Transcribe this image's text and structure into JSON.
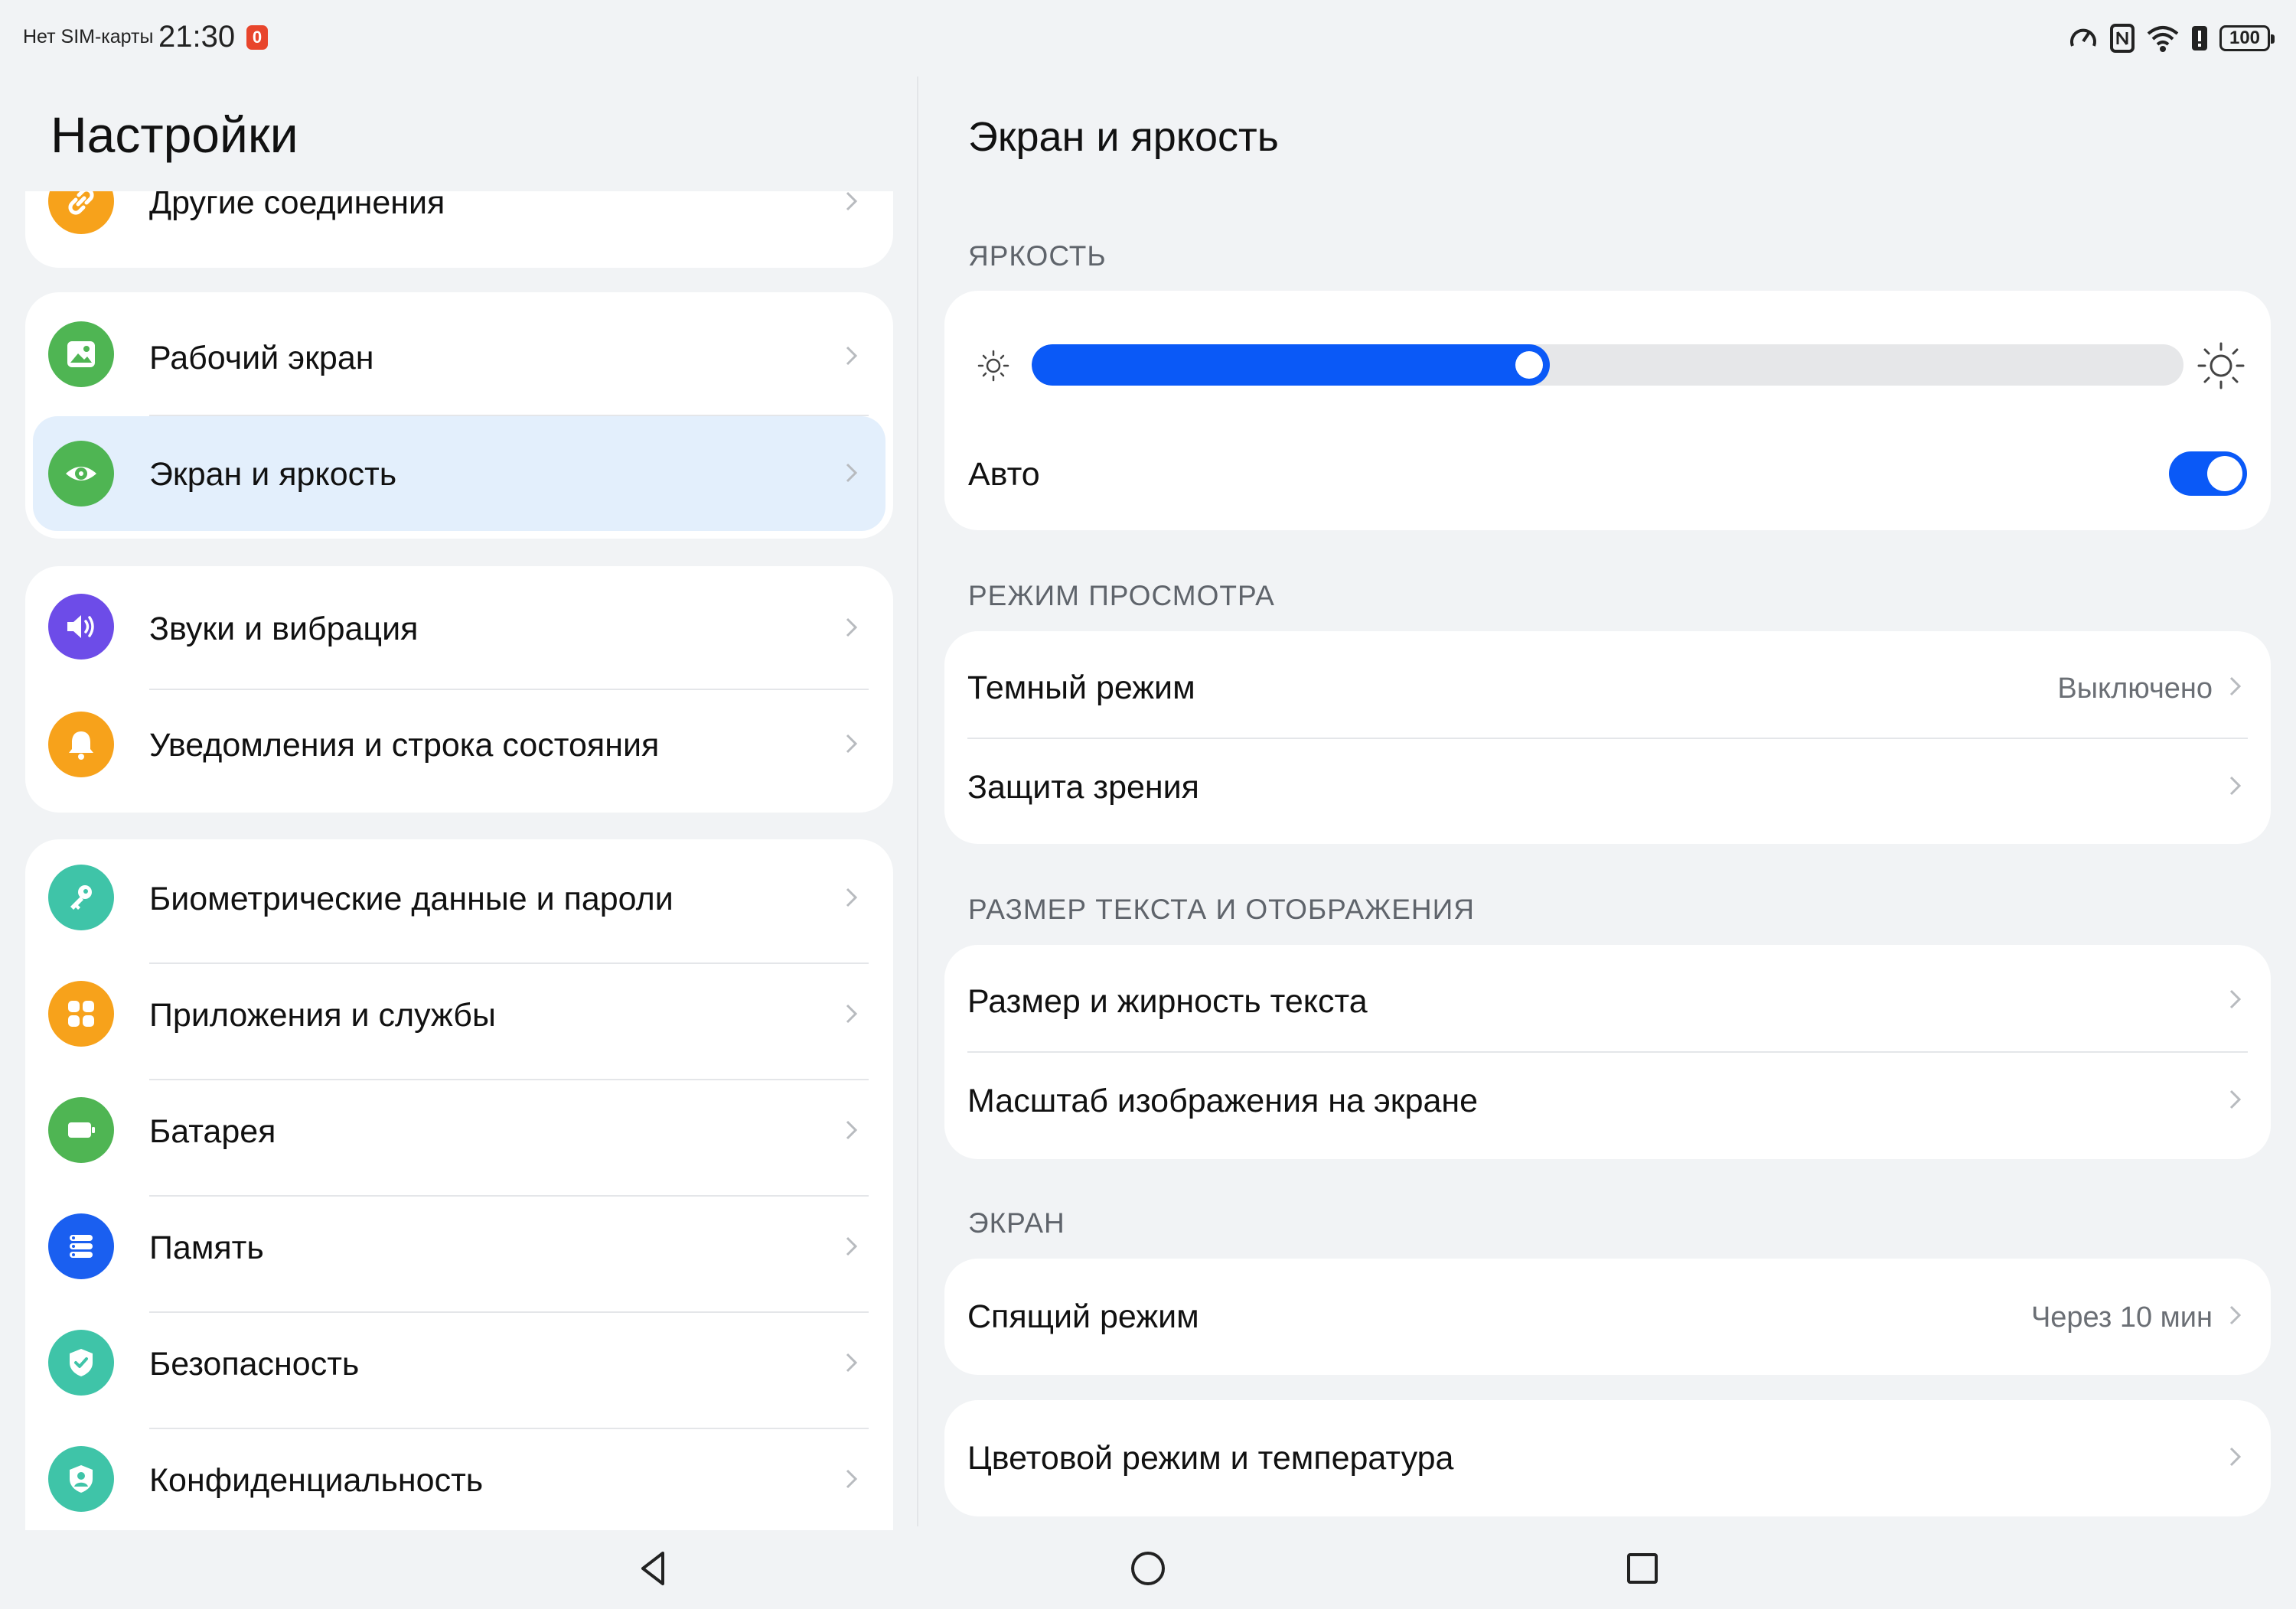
{
  "status_bar": {
    "sim_text": "Нет SIM-карты",
    "time": "21:30",
    "alert_badge": "0",
    "battery_level": "100",
    "icons": [
      "speed-icon",
      "nfc-icon",
      "wifi-icon",
      "battery-alert-icon",
      "battery-icon"
    ]
  },
  "left": {
    "title": "Настройки",
    "items": [
      {
        "label": "Другие соединения",
        "icon": "link-icon",
        "color": "#f7a21b"
      },
      {
        "label": "Рабочий экран",
        "icon": "picture-icon",
        "color": "#4fb553"
      },
      {
        "label": "Экран и яркость",
        "icon": "eye-icon",
        "color": "#4fb553",
        "selected": true
      },
      {
        "label": "Звуки и вибрация",
        "icon": "speaker-icon",
        "color": "#6d4ce8"
      },
      {
        "label": "Уведомления и строка состояния",
        "icon": "bell-icon",
        "color": "#f7a21b"
      },
      {
        "label": "Биометрические данные и пароли",
        "icon": "key-icon",
        "color": "#3fc4a8"
      },
      {
        "label": "Приложения и службы",
        "icon": "apps-icon",
        "color": "#f7a21b"
      },
      {
        "label": "Батарея",
        "icon": "battery-icon",
        "color": "#4fb553"
      },
      {
        "label": "Память",
        "icon": "storage-icon",
        "color": "#1a5ff0"
      },
      {
        "label": "Безопасность",
        "icon": "shield-check-icon",
        "color": "#3fc4a8"
      },
      {
        "label": "Конфиденциальность",
        "icon": "privacy-icon",
        "color": "#3fc4a8"
      }
    ]
  },
  "right": {
    "title": "Экран и яркость",
    "sections": {
      "brightness": "ЯРКОСТЬ",
      "view_mode": "РЕЖИМ ПРОСМОТРА",
      "text_size": "РАЗМЕР ТЕКСТА И ОТОБРАЖЕНИЯ",
      "screen": "ЭКРАН"
    },
    "brightness_level": 0.45,
    "auto_label": "Авто",
    "auto_enabled": true,
    "dark_mode": {
      "label": "Темный режим",
      "value": "Выключено"
    },
    "eye_comfort": {
      "label": "Защита зрения"
    },
    "text_weight": {
      "label": "Размер и жирность текста"
    },
    "display_scale": {
      "label": "Масштаб изображения на экране"
    },
    "sleep": {
      "label": "Спящий режим",
      "value": "Через 10 мин"
    },
    "color_temp": {
      "label": "Цветовой режим и температура"
    }
  },
  "colors": {
    "accent": "#0a59f7",
    "selected_row": "#e3effc",
    "background": "#f1f3f5"
  },
  "nav": [
    "back-icon",
    "home-icon",
    "recents-icon"
  ]
}
